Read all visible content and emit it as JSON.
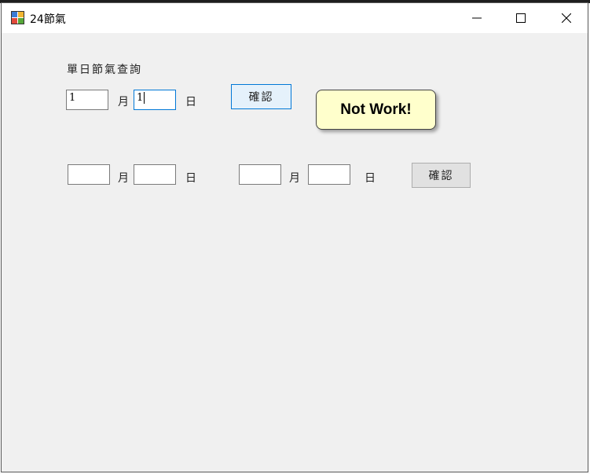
{
  "window": {
    "title": "24節氣"
  },
  "single_day": {
    "heading": "單日節氣查詢",
    "month_value": "1",
    "month_unit": "月",
    "day_value": "1",
    "day_unit": "日",
    "confirm_label": "確認"
  },
  "range": {
    "from_month_value": "",
    "from_month_unit": "月",
    "from_day_value": "",
    "from_day_unit": "日",
    "to_month_value": "",
    "to_month_unit": "月",
    "to_day_value": "",
    "to_day_unit": "日",
    "confirm_label": "確認"
  },
  "callout": {
    "text": "Not Work!",
    "color": "#ffffcc"
  },
  "colors": {
    "focus_border": "#0078d7",
    "client_bg": "#f0f0f0"
  }
}
